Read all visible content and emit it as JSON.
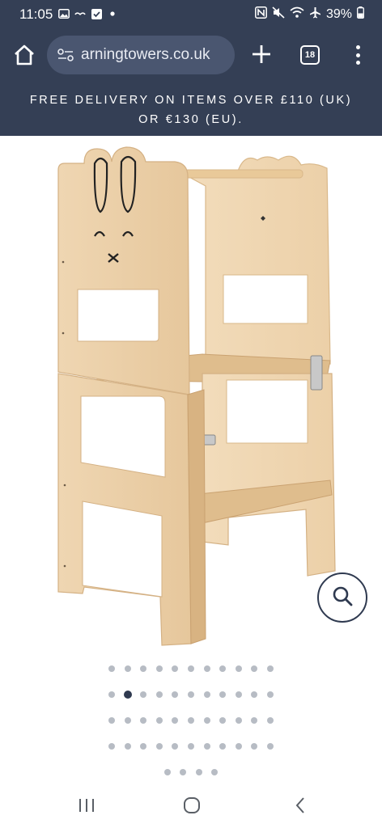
{
  "status_bar": {
    "time": "11:05",
    "battery": "39%",
    "left_icons": [
      "gallery-icon",
      "voicemail-icon",
      "check-square-icon",
      "dot-icon"
    ],
    "right_icons": [
      "nfc-icon",
      "mute-icon",
      "wifi-icon",
      "airplane-icon",
      "battery-icon"
    ]
  },
  "browser": {
    "url": "arningtowers.co.uk",
    "tab_count": "18",
    "home_icon": "home-icon",
    "site_settings_icon": "site-settings-icon",
    "new_tab_icon": "plus-icon",
    "menu_icon": "more-vert-icon"
  },
  "promo": {
    "line1": "FREE DELIVERY ON ITEMS OVER £110 (UK)",
    "line2": "OR €130 (EU)."
  },
  "product_image": {
    "alt": "Wooden bunny learning tower",
    "zoom_icon": "search-icon"
  },
  "gallery": {
    "rows": [
      11,
      11,
      11,
      11,
      4
    ],
    "active_row": 1,
    "active_index": 1
  },
  "navbar": {
    "recents_icon": "recents-icon",
    "home_icon": "home-circle-icon",
    "back_icon": "back-chevron-icon"
  },
  "colors": {
    "chrome": "#343f55",
    "accent": "#2f3a50",
    "wood": "#ecd2ad",
    "dot_inactive": "#b7bcc4"
  }
}
